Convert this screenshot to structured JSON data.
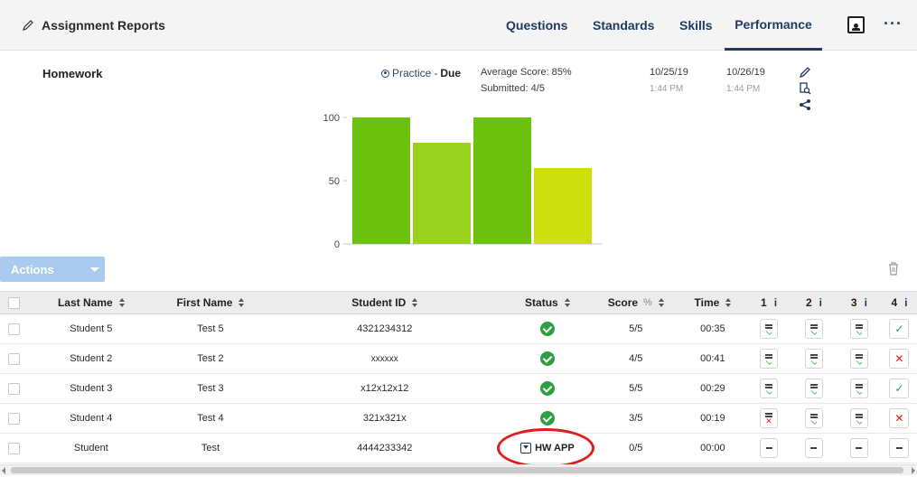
{
  "app": {
    "title": "Assignment Reports",
    "icon": "pencil-icon"
  },
  "tabs": [
    {
      "label": "Questions"
    },
    {
      "label": "Standards"
    },
    {
      "label": "Skills"
    },
    {
      "label": "Performance",
      "active": true
    }
  ],
  "header": {
    "title": "Homework",
    "mode": "Practice",
    "mode_sep": " - ",
    "status": "Due",
    "average_score": "Average Score: 85%",
    "submitted": "Submitted: 4/5",
    "start_date": "10/25/19",
    "start_time": "1:44 PM",
    "due_date": "10/26/19",
    "due_time": "1:44 PM"
  },
  "chart_data": {
    "type": "bar",
    "values": [
      100,
      80,
      100,
      60
    ],
    "colors": [
      "#6cc10f",
      "#9ad31f",
      "#6cc10f",
      "#cde00e"
    ],
    "ylim": [
      0,
      100
    ],
    "yticks": [
      "0",
      "50",
      "100"
    ],
    "grid": false
  },
  "toolbar": {
    "actions_label": "Actions"
  },
  "table": {
    "headers": {
      "last_name": "Last Name",
      "first_name": "First Name",
      "student_id": "Student ID",
      "status": "Status",
      "score": "Score",
      "score_unit": "%",
      "time": "Time",
      "q1": "1",
      "q2": "2",
      "q3": "3",
      "q4": "4",
      "info": "i"
    },
    "rows": [
      {
        "last": "Student 5",
        "first": "Test 5",
        "id": "4321234312",
        "status": "complete",
        "score": "5/5",
        "time": "00:35"
      },
      {
        "last": "Student 2",
        "first": "Test 2",
        "id": "xxxxxx",
        "status": "complete",
        "score": "4/5",
        "time": "00:41"
      },
      {
        "last": "Student 3",
        "first": "Test 3",
        "id": "x12x12x12",
        "status": "complete",
        "score": "5/5",
        "time": "00:29"
      },
      {
        "last": "Student 4",
        "first": "Test 4",
        "id": "321x321x",
        "status": "complete",
        "score": "3/5",
        "time": "00:19"
      },
      {
        "last": "Student",
        "first": "Test",
        "id": "4444233342",
        "status": "HW APP",
        "score": "0/5",
        "time": "00:00"
      }
    ]
  },
  "colors": {
    "accent": "#1f3a5f",
    "success": "#2ea043",
    "error": "#e21d1d",
    "actions_bg": "#a9cbf0",
    "annotation": "#e21d1d"
  }
}
